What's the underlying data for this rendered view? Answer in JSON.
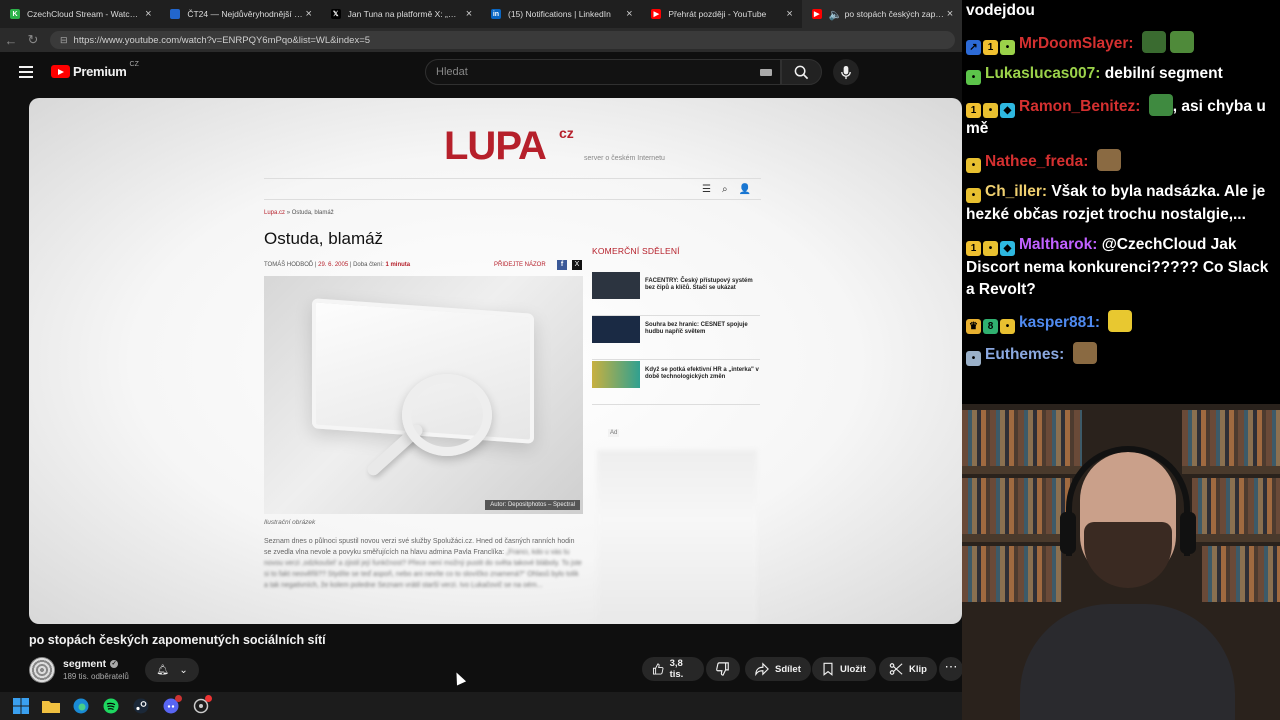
{
  "tabs": [
    {
      "title": "CzechCloud Stream - Watch Live o",
      "icon_color": "#2db24a",
      "glyph": "K",
      "active": false
    },
    {
      "title": "ČT24 — Nejdůvěryhodnější zpravo",
      "icon_color": "#2266cc",
      "glyph": "",
      "active": false
    },
    {
      "title": "Jan Tuna na platformě X: „MIMOŘ",
      "icon_color": "#000000",
      "glyph": "𝕏",
      "active": false
    },
    {
      "title": "(15) Notifications | LinkedIn",
      "icon_color": "#0a66c2",
      "glyph": "in",
      "active": false
    },
    {
      "title": "Přehrát později - YouTube",
      "icon_color": "#ff0000",
      "glyph": "▶",
      "active": false
    },
    {
      "title": "po stopách českých zapomenutýc",
      "icon_color": "#ff0000",
      "glyph": "▶",
      "active": true
    }
  ],
  "address": {
    "url": "https://www.youtube.com/watch?v=ENRPQY6mPqo&list=WL&index=5"
  },
  "yt": {
    "logo": "Premium",
    "country": "CZ",
    "search_placeholder": "Hledat"
  },
  "video": {
    "lupa": {
      "logo": "LUPA",
      "logo_cz": "cz",
      "subtitle": "server o českém Internetu",
      "crumb_site": "Lupa.cz",
      "crumb_sep": "»",
      "crumb_page": "Ostuda, blamáž",
      "title": "Ostuda, blamáž",
      "author": "TOMÁŠ HODBOĎ",
      "date": "29. 6. 2005",
      "read_label": "Doba čtení:",
      "read_value": "1 minuta",
      "opinion": "PŘIDEJTE NÁZOR",
      "image_credit": "Autor: Depositphotos – Spectral",
      "caption": "Ilustrační obrázek",
      "perex_a": "Seznam dnes o půlnoci spustil novou verzi své služby Spolužáci.cz. Hned od časných ranních hodin se zvedla vlna nevole a povyku směřujících na hlavu admina Pavla Franclíka:",
      "perex_b": "„Franci, kdo u vás tu novou verzi ,odzkoušel' a zjistil její funkčnost? Přece není možný pustit do světa takové bláboly. To jste si to fakt neověřili?? Stydíte se teď aspoň, nebo ani nevíte co to slovíčko znamená?\" Ohlasů bylo tolik a tak negativních, že kolem poledne Seznam vrátil starší verzi. Ivo Lukačovič se na oém...",
      "commercial_heading": "KOMERČNÍ SDĚLENÍ",
      "commercial": [
        {
          "text": "FACENTRY: Český přístupový systém bez čipů a klíčů. Stačí se ukázat",
          "thumb": "#2c3440"
        },
        {
          "text": "Souhra bez hranic: CESNET spojuje hudbu napříč světem",
          "thumb": "#1a2a44"
        },
        {
          "text": "Když se potká efektivní HR a „interka\" v době technologických změn",
          "thumb": "#c8b040"
        }
      ],
      "ad_label": "Ad"
    },
    "title": "po stopách českých zapomenutých sociálních sítí",
    "channel": "segment",
    "subscribers": "189 tis. odběratelů",
    "likes": "3,8 tis.",
    "share": "Sdílet",
    "save": "Uložit",
    "clip": "Klip"
  },
  "chat": [
    {
      "user": "",
      "color": "#ffffff",
      "badges": [],
      "text": "vodejdou",
      "emotes": []
    },
    {
      "user": "MrDoomSlayer",
      "color": "#d43030",
      "badges": [
        {
          "c": "#2c6ad6",
          "g": "↗"
        },
        {
          "c": "#f0c030",
          "g": "1"
        },
        {
          "c": "#9bd24a",
          "g": "•"
        }
      ],
      "text": "",
      "emotes": [
        "#3a6b30",
        "#4f8a3a"
      ]
    },
    {
      "user": "Lukaslucas007",
      "color": "#9bd24a",
      "badges": [
        {
          "c": "#5cc44a",
          "g": "•"
        }
      ],
      "text": "debilní segment",
      "emotes": []
    },
    {
      "user": "Ramon_Benitez",
      "color": "#d43030",
      "badges": [
        {
          "c": "#f0c030",
          "g": "1"
        },
        {
          "c": "#e8c030",
          "g": "•"
        },
        {
          "c": "#2eb8e0",
          "g": "◆"
        }
      ],
      "text": ", asi chyba u mě",
      "emotes": [
        "#3f8a40"
      ]
    },
    {
      "user": "Nathee_freda",
      "color": "#d43030",
      "badges": [
        {
          "c": "#e8c030",
          "g": "•"
        }
      ],
      "text": "",
      "emotes": [
        "#8a6a42"
      ]
    },
    {
      "user": "Ch_iller",
      "color": "#f0d070",
      "badges": [
        {
          "c": "#e8c030",
          "g": "•"
        }
      ],
      "text": "Však to byla nadsázka. Ale je hezké občas rozjet trochu nostalgie,...",
      "emotes": []
    },
    {
      "user": "Maltharok",
      "color": "#c061ff",
      "badges": [
        {
          "c": "#f0c030",
          "g": "1"
        },
        {
          "c": "#e8c030",
          "g": "•"
        },
        {
          "c": "#2eb8e0",
          "g": "◆"
        }
      ],
      "text": "@CzechCloud Jak Discort nema konkurenci????? Co Slack a Revolt?",
      "emotes": []
    },
    {
      "user": "kasper881",
      "color": "#4f8af0",
      "badges": [
        {
          "c": "#e8b030",
          "g": "♛"
        },
        {
          "c": "#30b070",
          "g": "8"
        },
        {
          "c": "#e8c030",
          "g": "•"
        }
      ],
      "text": "",
      "emotes": [
        "#e8c830"
      ]
    },
    {
      "user": "Euthemes",
      "color": "#8aa8e0",
      "badges": [
        {
          "c": "#9ab0c8",
          "g": "•"
        }
      ],
      "text": "",
      "emotes": [
        "#8a6a42"
      ]
    }
  ]
}
